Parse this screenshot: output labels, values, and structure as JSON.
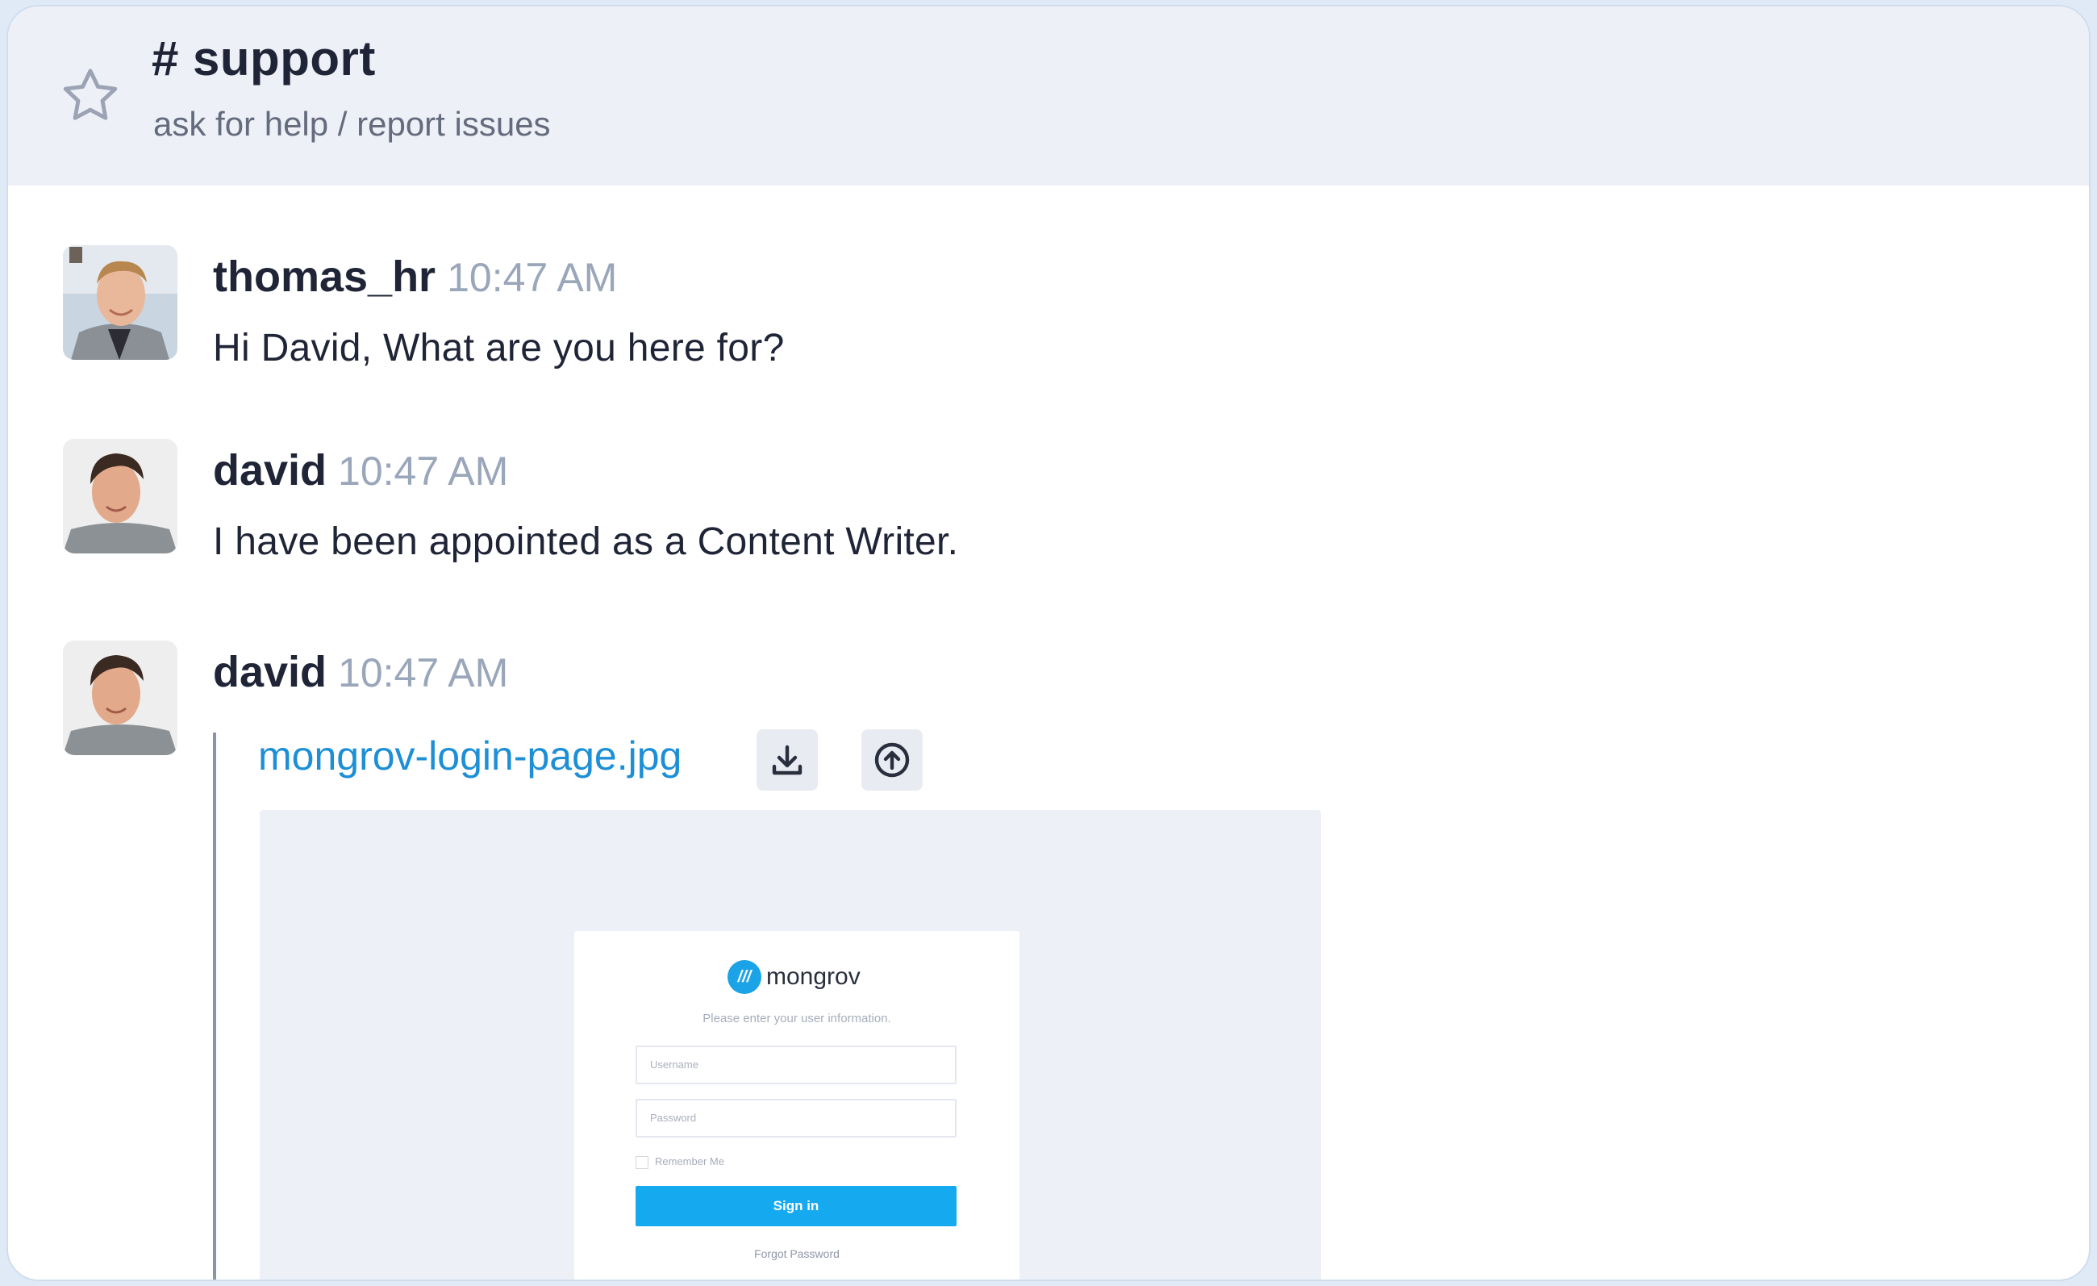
{
  "channel": {
    "name": "# support",
    "topic": "ask for help / report issues"
  },
  "messages": [
    {
      "author": "thomas_hr",
      "time": "10:47 AM",
      "text": "Hi David, What are you here for?"
    },
    {
      "author": "david",
      "time": "10:47 AM",
      "text": "I have been appointed as a Content Writer."
    },
    {
      "author": "david",
      "time": "10:47 AM",
      "text": ""
    }
  ],
  "attachment": {
    "file_name": "mongrov-login-page.jpg",
    "download_icon": "download-icon",
    "upload_icon": "upload-circle-icon",
    "preview": {
      "logo_mark": "///",
      "logo_text": "mongrov",
      "subtitle": "Please enter your user information.",
      "username_placeholder": "Username",
      "password_placeholder": "Password",
      "remember_label": "Remember Me",
      "signin_label": "Sign in",
      "forgot_label": "Forgot Password"
    }
  },
  "colors": {
    "header_bg": "#eef0f7",
    "link": "#1c8fd6",
    "timestamp": "#9aa6ba",
    "signin_button": "#15aaf0"
  }
}
